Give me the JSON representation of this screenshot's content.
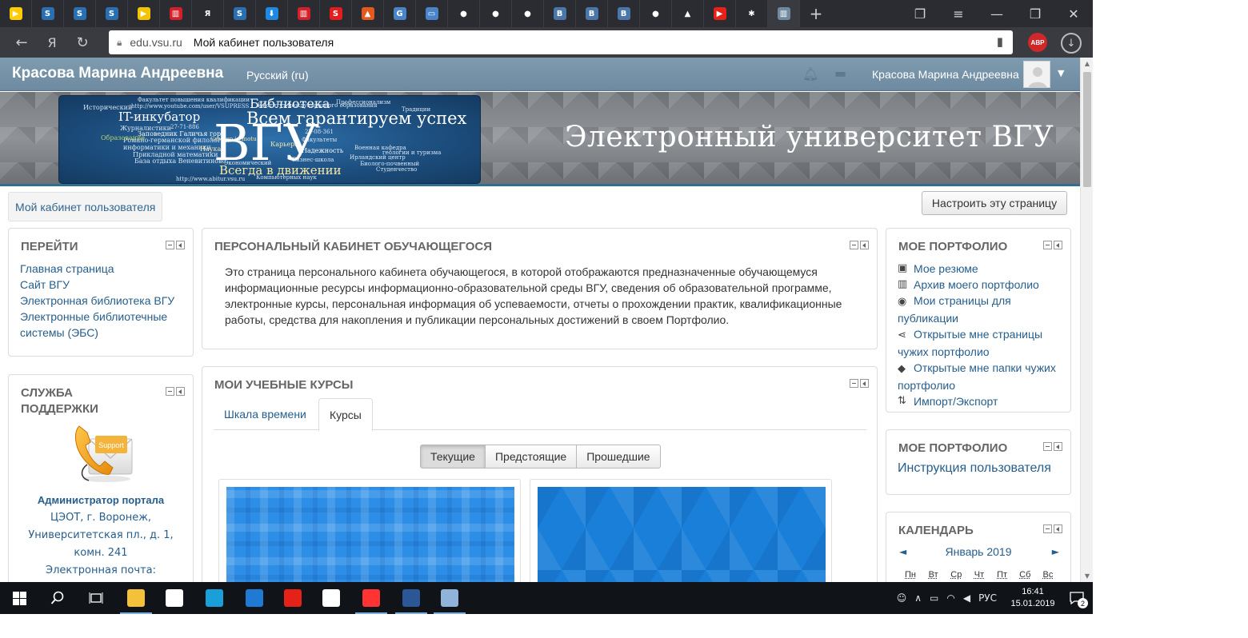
{
  "browser": {
    "tabs": [
      {
        "icon": "yandex-zen-icon",
        "color": "#ffcc00",
        "glyph": "▶"
      },
      {
        "icon": "vsu-s-icon",
        "color": "#2a6fb1",
        "glyph": "S"
      },
      {
        "icon": "vsu-s-icon",
        "color": "#2a6fb1",
        "glyph": "S"
      },
      {
        "icon": "vsu-s-icon",
        "color": "#2a6fb1",
        "glyph": "S"
      },
      {
        "icon": "yandex-player-icon",
        "color": "#f5c400",
        "glyph": "▶"
      },
      {
        "icon": "book-icon",
        "color": "#d4202b",
        "glyph": "▥"
      },
      {
        "icon": "yandex-icon",
        "color": "#2b2c31",
        "glyph": "Я"
      },
      {
        "icon": "vsu-s-icon",
        "color": "#2a6fb1",
        "glyph": "S"
      },
      {
        "icon": "download-icon",
        "color": "#1e88e5",
        "glyph": "⬇"
      },
      {
        "icon": "book-icon",
        "color": "#d4202b",
        "glyph": "▥"
      },
      {
        "icon": "s-red-icon",
        "color": "#e31d1d",
        "glyph": "S"
      },
      {
        "icon": "chart-orange-icon",
        "color": "#e35a1e",
        "glyph": "▲"
      },
      {
        "icon": "translate-icon",
        "color": "#4a84c8",
        "glyph": "G"
      },
      {
        "icon": "message-icon",
        "color": "#4a84c8",
        "glyph": "▭"
      },
      {
        "icon": "github-icon",
        "color": "#2b2c31",
        "glyph": "●"
      },
      {
        "icon": "github-icon",
        "color": "#2b2c31",
        "glyph": "●"
      },
      {
        "icon": "github-icon",
        "color": "#2b2c31",
        "glyph": "●"
      },
      {
        "icon": "vk-icon",
        "color": "#4a76a8",
        "glyph": "B"
      },
      {
        "icon": "vk-icon",
        "color": "#4a76a8",
        "glyph": "B"
      },
      {
        "icon": "vk-icon",
        "color": "#4a76a8",
        "glyph": "B"
      },
      {
        "icon": "github-icon",
        "color": "#2b2c31",
        "glyph": "●"
      },
      {
        "icon": "google-drive-icon",
        "color": "#2b2c31",
        "glyph": "▲"
      },
      {
        "icon": "youtube-icon",
        "color": "#e62117",
        "glyph": "▶"
      },
      {
        "icon": "bug-icon",
        "color": "#2b2c31",
        "glyph": "✱"
      },
      {
        "icon": "moodle-site-icon",
        "color": "#6f8aa0",
        "glyph": "▥"
      }
    ],
    "url_domain": "edu.vsu.ru",
    "url_title": "Мой кабинет пользователя",
    "back_icon": "←",
    "yandex_letter": "Я",
    "reload_icon": "↻",
    "adblock_label": "ABP"
  },
  "navbar": {
    "site_name": "Красова Марина Андреевна",
    "language": "Русский (ru)",
    "user_name": "Красова Марина Андреевна"
  },
  "banner": {
    "title": "Электронный университет ВГУ",
    "logo_main": "ВГУ",
    "logo_words": [
      "Библиотека",
      "IT-инкубатор",
      "Всем гарантируем успех",
      "Всегда в движении",
      "Исторический",
      "Факультет повышения квалификации",
      "http://www.youtube.com/user/VSUPRESS",
      "Профессионализм",
      "Институт международного образования",
      "Традиции",
      "Журналистики",
      "Заповедник Галичья гора",
      "Романо-германской филологии",
      "информатики и механики",
      "Прикладной математики",
      "База отдыха Веневитиново",
      "Экономический",
      "Бизнес-школа",
      "Ирландский центр",
      "Студенчество",
      "http://www.abitur.vsu.ru",
      "Компьютерных наук",
      "Надежность",
      "Военная кафедра",
      "геологии и туризма",
      "Биолого-почвенный",
      "22-08-361",
      "27-71-886",
      "Семпер in motu",
      "Факультеты",
      "Образование",
      "Наука",
      "Карьера"
    ]
  },
  "page": {
    "breadcrumb": "Мой кабинет пользователя",
    "customize_button": "Настроить эту страницу"
  },
  "blocks": {
    "nav": {
      "title": "ПЕРЕЙТИ",
      "links": [
        "Главная страница",
        "Сайт ВГУ",
        "Электронная библиотека ВГУ",
        "Электронные библиотечные системы (ЭБС)"
      ]
    },
    "support": {
      "title": "СЛУЖБА ПОДДЕРЖКИ",
      "image_label": "Support",
      "admin": "Администратор портала",
      "lines": [
        "ЦЭОТ, г. Воронеж,",
        "Университетская пл., д. 1,",
        "комн. 241",
        "Электронная почта:"
      ]
    },
    "intro": {
      "title": "ПЕРСОНАЛЬНЫЙ КАБИНЕТ ОБУЧАЮЩЕГОСЯ",
      "text": "Это страница персонального кабинета обучающегося, в которой отображаются предназначенные обучающемуся информационные ресурсы информационно-образовательной среды ВГУ, сведения об образовательной программе, электронные курсы, персональная информация об успеваемости, отчеты о прохождении практик, квалификационные работы, средства для накопления и публикации персональных достижений в своем Портфолио."
    },
    "courses": {
      "title": "МОИ УЧЕБНЫЕ КУРСЫ",
      "tabs": [
        "Шкала времени",
        "Курсы"
      ],
      "selected_tab": "Курсы",
      "filters": [
        "Текущие",
        "Предстоящие",
        "Прошедшие"
      ],
      "selected_filter": "Текущие"
    },
    "portfolio": {
      "title": "МОЕ ПОРТФОЛИО",
      "items": [
        {
          "icon": "resume-icon",
          "glyph": "▣",
          "label": "Мое резюме"
        },
        {
          "icon": "archive-icon",
          "glyph": "▥",
          "label": "Архив моего портфолио"
        },
        {
          "icon": "eye-icon",
          "glyph": "◉",
          "label": "Мои страницы для публикации"
        },
        {
          "icon": "share-icon",
          "glyph": "⋖",
          "label": "Открытые мне страницы чужих портфолио"
        },
        {
          "icon": "tags-icon",
          "glyph": "◆",
          "label": "Открытые мне папки чужих портфолио"
        },
        {
          "icon": "import-export-icon",
          "glyph": "⇅",
          "label": "Импорт/Экспорт"
        }
      ]
    },
    "portfolio2": {
      "title": "МОЕ ПОРТФОЛИО",
      "link": "Инструкция пользователя"
    },
    "calendar": {
      "title": "КАЛЕНДАРЬ",
      "prev": "◄",
      "next": "►",
      "month": "Январь 2019",
      "days": [
        "Пн",
        "Вт",
        "Ср",
        "Чт",
        "Пт",
        "Сб",
        "Вс"
      ]
    }
  },
  "taskbar": {
    "apps": [
      {
        "icon": "windows-start-icon",
        "color": "#ffffff"
      },
      {
        "icon": "search-icon",
        "color": "#ffffff"
      },
      {
        "icon": "task-view-icon",
        "color": "#ffffff"
      },
      {
        "icon": "file-explorer-icon",
        "color": "#f3c13a"
      },
      {
        "icon": "store-icon",
        "color": "#ffffff"
      },
      {
        "icon": "l-app-icon",
        "color": "#1aa0d8"
      },
      {
        "icon": "edge-icon",
        "color": "#1f7ad3"
      },
      {
        "icon": "red-app-icon",
        "color": "#e62117"
      },
      {
        "icon": "mail-icon",
        "color": "#ffffff"
      },
      {
        "icon": "yandex-browser-icon",
        "color": "#ff3333"
      },
      {
        "icon": "word-icon",
        "color": "#2b5797"
      },
      {
        "icon": "paint-icon",
        "color": "#8fb3d9"
      }
    ],
    "language": "РУС",
    "time": "16:41",
    "date": "15.01.2019",
    "notifications": "2"
  }
}
